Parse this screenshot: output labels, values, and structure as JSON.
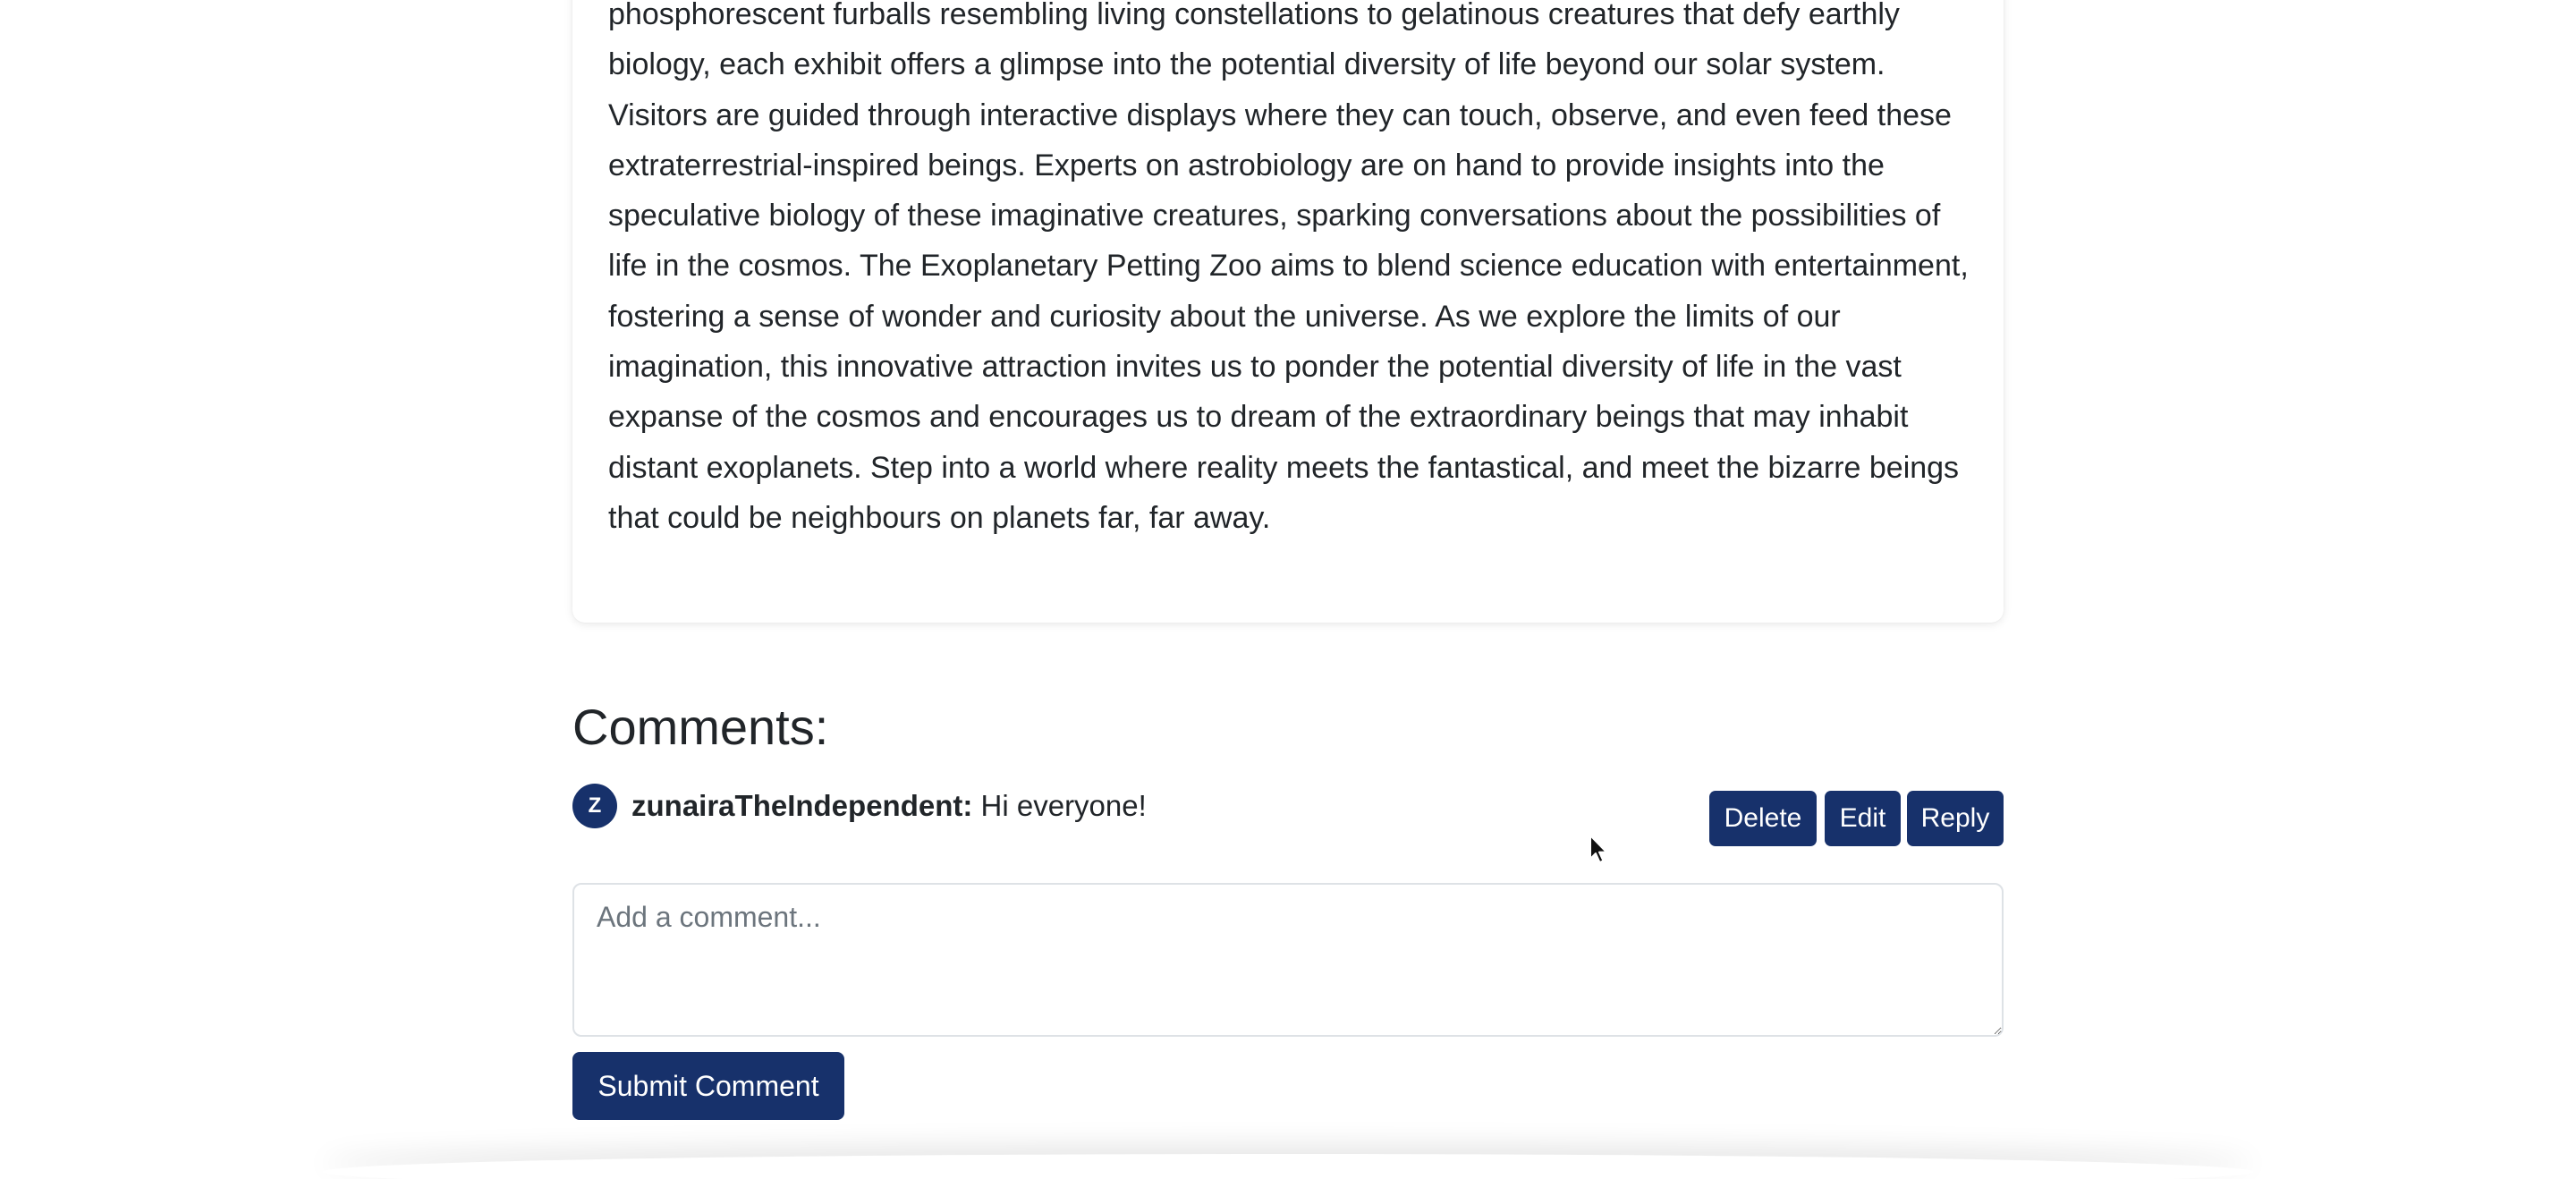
{
  "post": {
    "body": "phosphorescent furballs resembling living constellations to gelatinous creatures that defy earthly biology, each exhibit offers a glimpse into the potential diversity of life beyond our solar system. Visitors are guided through interactive displays where they can touch, observe, and even feed these extraterrestrial-inspired beings. Experts on astrobiology are on hand to provide insights into the speculative biology of these imaginative creatures, sparking conversations about the possibilities of life in the cosmos. The Exoplanetary Petting Zoo aims to blend science education with entertainment, fostering a sense of wonder and curiosity about the universe. As we explore the limits of our imagination, this innovative attraction invites us to ponder the potential diversity of life in the vast expanse of the cosmos and encourages us to dream of the extraordinary beings that may inhabit distant exoplanets. Step into a world where reality meets the fantastical, and meet the bizarre beings that could be neighbours on planets far, far away."
  },
  "comments": {
    "heading": "Comments:",
    "items": [
      {
        "avatar_initial": "Z",
        "author": "zunairaTheIndependent:",
        "text": " Hi everyone!",
        "actions": {
          "delete_label": "Delete",
          "edit_label": "Edit",
          "reply_label": "Reply"
        }
      }
    ],
    "input_placeholder": "Add a comment...",
    "submit_label": "Submit Comment"
  },
  "theme": {
    "primary": "#17316b",
    "text": "#212529",
    "placeholder": "#6c757d"
  },
  "icons": {
    "cursor": "mouse-pointer-icon"
  }
}
